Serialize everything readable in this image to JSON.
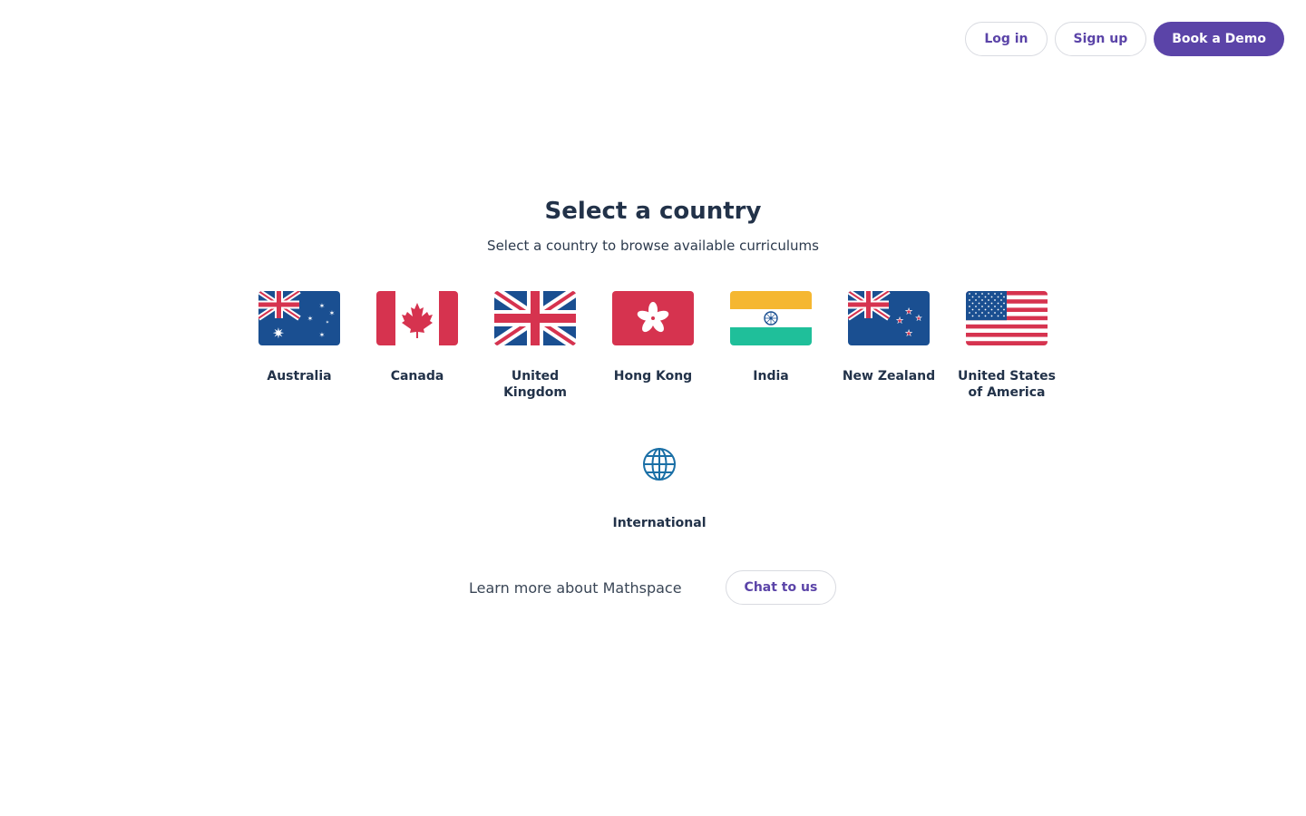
{
  "header": {
    "login_label": "Log in",
    "signup_label": "Sign up",
    "demo_label": "Book a Demo"
  },
  "main": {
    "title": "Select a country",
    "subtitle": "Select a country to browse available curriculums",
    "countries": [
      {
        "label": "Australia",
        "icon": "australia-flag-icon"
      },
      {
        "label": "Canada",
        "icon": "canada-flag-icon"
      },
      {
        "label": "United Kingdom",
        "icon": "united-kingdom-flag-icon"
      },
      {
        "label": "Hong Kong",
        "icon": "hong-kong-flag-icon"
      },
      {
        "label": "India",
        "icon": "india-flag-icon"
      },
      {
        "label": "New Zealand",
        "icon": "new-zealand-flag-icon"
      },
      {
        "label": "United States of America",
        "icon": "usa-flag-icon"
      }
    ],
    "international": {
      "label": "International",
      "icon": "globe-icon"
    }
  },
  "footer": {
    "learn_text": "Learn more about Mathspace",
    "chat_label": "Chat to us"
  },
  "colors": {
    "brand": "#5b44a8",
    "heading": "#223249",
    "border": "#d9dbe1"
  }
}
